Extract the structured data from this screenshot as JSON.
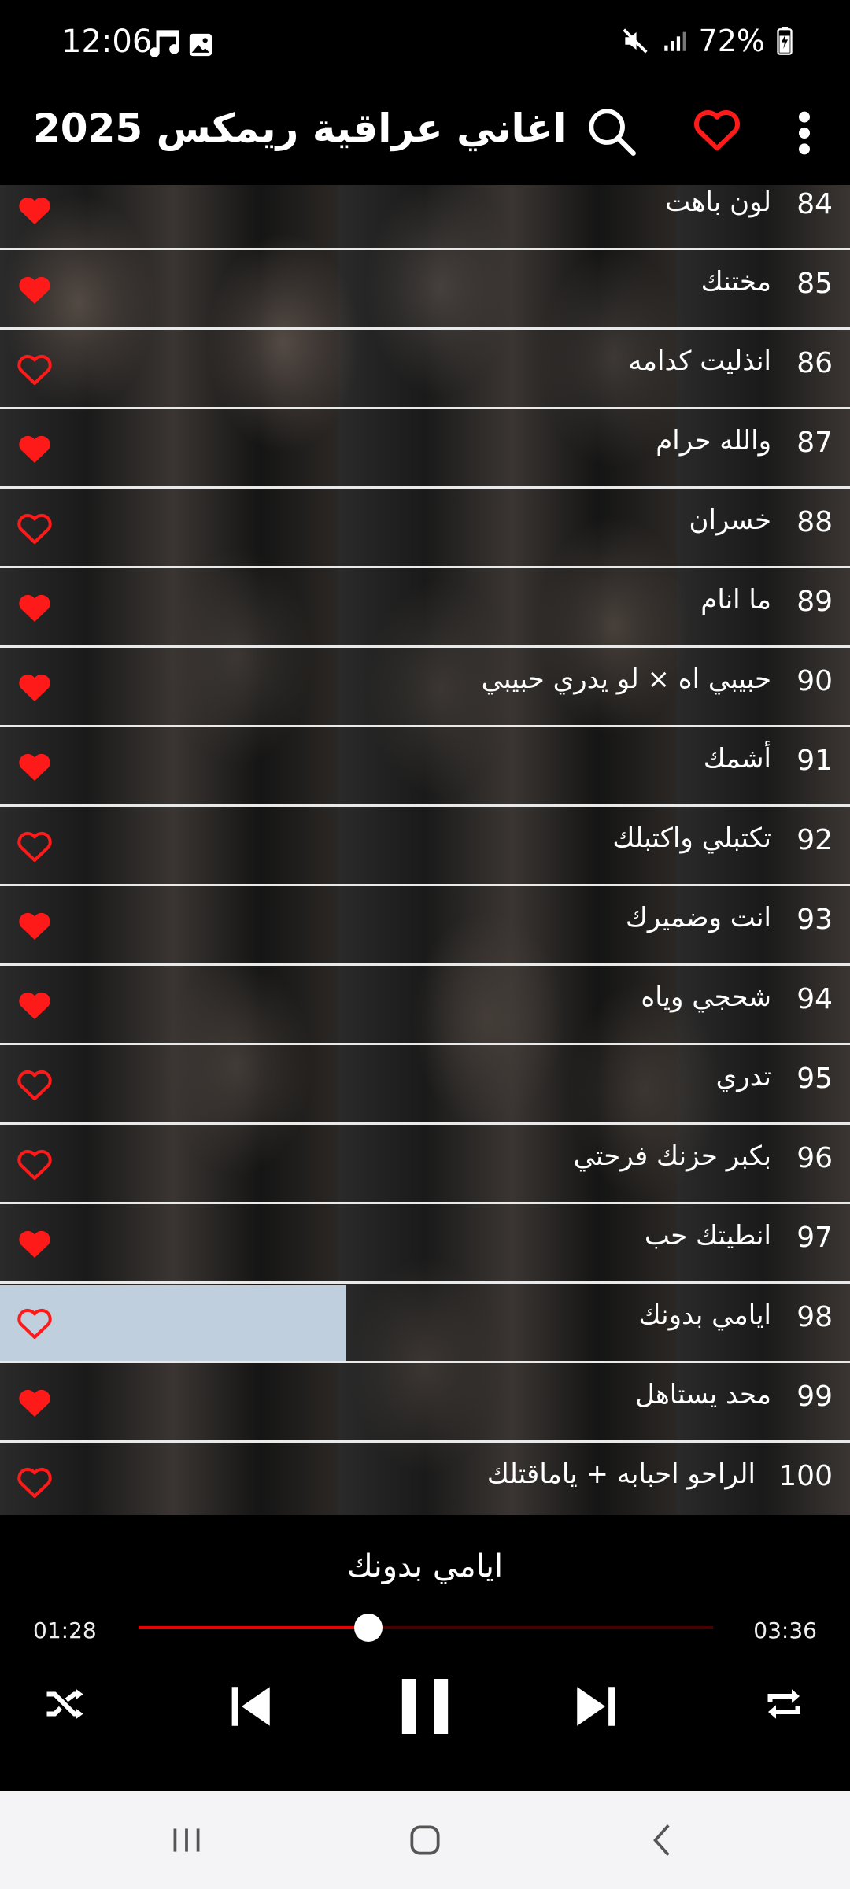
{
  "status_bar": {
    "time": "12:06",
    "battery": "72%",
    "icons": [
      "music-note-icon",
      "gallery-icon",
      "mute-icon",
      "signal-icon",
      "battery-charging-icon"
    ]
  },
  "app_bar": {
    "title": "اغاني عراقية ريمكس 2025",
    "icons": [
      "search-icon",
      "heart-outline-icon",
      "more-vert-icon"
    ]
  },
  "songs": [
    {
      "num": "84",
      "title": "لون باهت",
      "favorite": true
    },
    {
      "num": "85",
      "title": "مختنك",
      "favorite": true
    },
    {
      "num": "86",
      "title": "انذليت كدامه",
      "favorite": false
    },
    {
      "num": "87",
      "title": "والله حرام",
      "favorite": true
    },
    {
      "num": "88",
      "title": "خسران",
      "favorite": false
    },
    {
      "num": "89",
      "title": "ما انام",
      "favorite": true
    },
    {
      "num": "90",
      "title": "حبيبي اه × لو يدري حبيبي",
      "favorite": true
    },
    {
      "num": "91",
      "title": "أشمك",
      "favorite": true
    },
    {
      "num": "92",
      "title": "تكتبلي واكتبلك",
      "favorite": false
    },
    {
      "num": "93",
      "title": "انت وضميرك",
      "favorite": true
    },
    {
      "num": "94",
      "title": "شحجي وياه",
      "favorite": true
    },
    {
      "num": "95",
      "title": "تدري",
      "favorite": false
    },
    {
      "num": "96",
      "title": "بكبر حزنك فرحتي",
      "favorite": false
    },
    {
      "num": "97",
      "title": "انطيتك حب",
      "favorite": true
    },
    {
      "num": "98",
      "title": "ايامي بدونك",
      "favorite": false,
      "active": true
    },
    {
      "num": "99",
      "title": "محد يستاهل",
      "favorite": true
    },
    {
      "num": "100",
      "title": "الراحو احبابه + ياماقتلك",
      "favorite": false
    }
  ],
  "player": {
    "now_playing": "ايامي بدونك",
    "current_time": "01:28",
    "total_time": "03:36",
    "progress": 0.4,
    "controls": [
      "shuffle-icon",
      "previous-icon",
      "pause-icon",
      "next-icon",
      "repeat-icon"
    ]
  },
  "colors": {
    "accent": "#e00000",
    "heart": "#ff1a1a",
    "active_row": "#bfcfdd",
    "row_divider": "#e9e9e9"
  },
  "nav_bar": {
    "icons": [
      "recents-icon",
      "home-icon",
      "back-icon"
    ]
  }
}
